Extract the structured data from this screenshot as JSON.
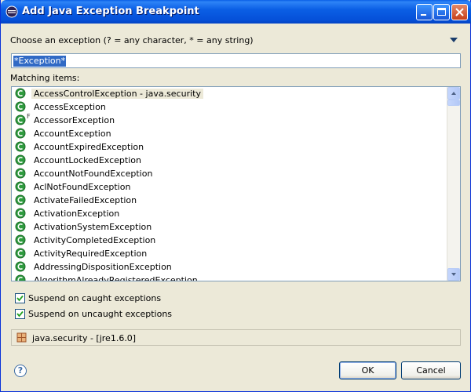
{
  "window": {
    "title": "Add Java Exception Breakpoint"
  },
  "prompt": "Choose an exception (? = any character, * = any string)",
  "search": {
    "value": "*Exception*"
  },
  "matching_label": "Matching items:",
  "items": [
    "AccessControlException - java.security",
    "AccessException",
    "AccessorException",
    "AccountException",
    "AccountExpiredException",
    "AccountLockedException",
    "AccountNotFoundException",
    "AclNotFoundException",
    "ActivateFailedException",
    "ActivationException",
    "ActivationSystemException",
    "ActivityCompletedException",
    "ActivityRequiredException",
    "AddressingDispositionException",
    "AlgorithmAlreadyRegisteredException"
  ],
  "item_overlay": "F",
  "checkboxes": {
    "caught": {
      "label": "Suspend on caught exceptions",
      "checked": true
    },
    "uncaught": {
      "label": "Suspend on uncaught exceptions",
      "checked": true
    }
  },
  "status": "java.security - [jre1.6.0]",
  "buttons": {
    "ok": "OK",
    "cancel": "Cancel"
  },
  "help_icon": "?",
  "colors": {
    "selection": "#316AC5",
    "titlebar": "#0550D8",
    "class_icon": "#2E9A3E"
  }
}
